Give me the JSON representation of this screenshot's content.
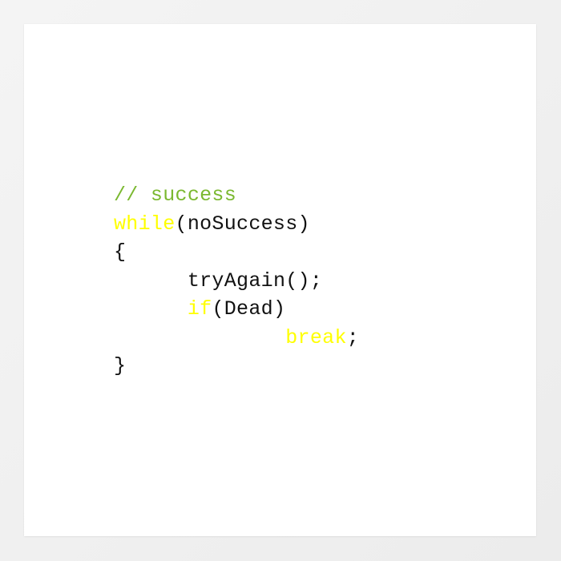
{
  "colors": {
    "comment": "#7ab82f",
    "keyword": "#ffff00",
    "text": "#111111",
    "background": "#ffffff"
  },
  "code": {
    "line1": {
      "comment": "// success"
    },
    "line2": {
      "keyword": "while",
      "rest": "(noSuccess)"
    },
    "line3": {
      "text": "{"
    },
    "line4": {
      "indent": "      ",
      "text": "tryAgain();"
    },
    "line5": {
      "indent": "      ",
      "keyword": "if",
      "rest": "(Dead)"
    },
    "line6": {
      "indent": "              ",
      "keyword": "break",
      "rest": ";"
    },
    "line7": {
      "text": "}"
    }
  }
}
